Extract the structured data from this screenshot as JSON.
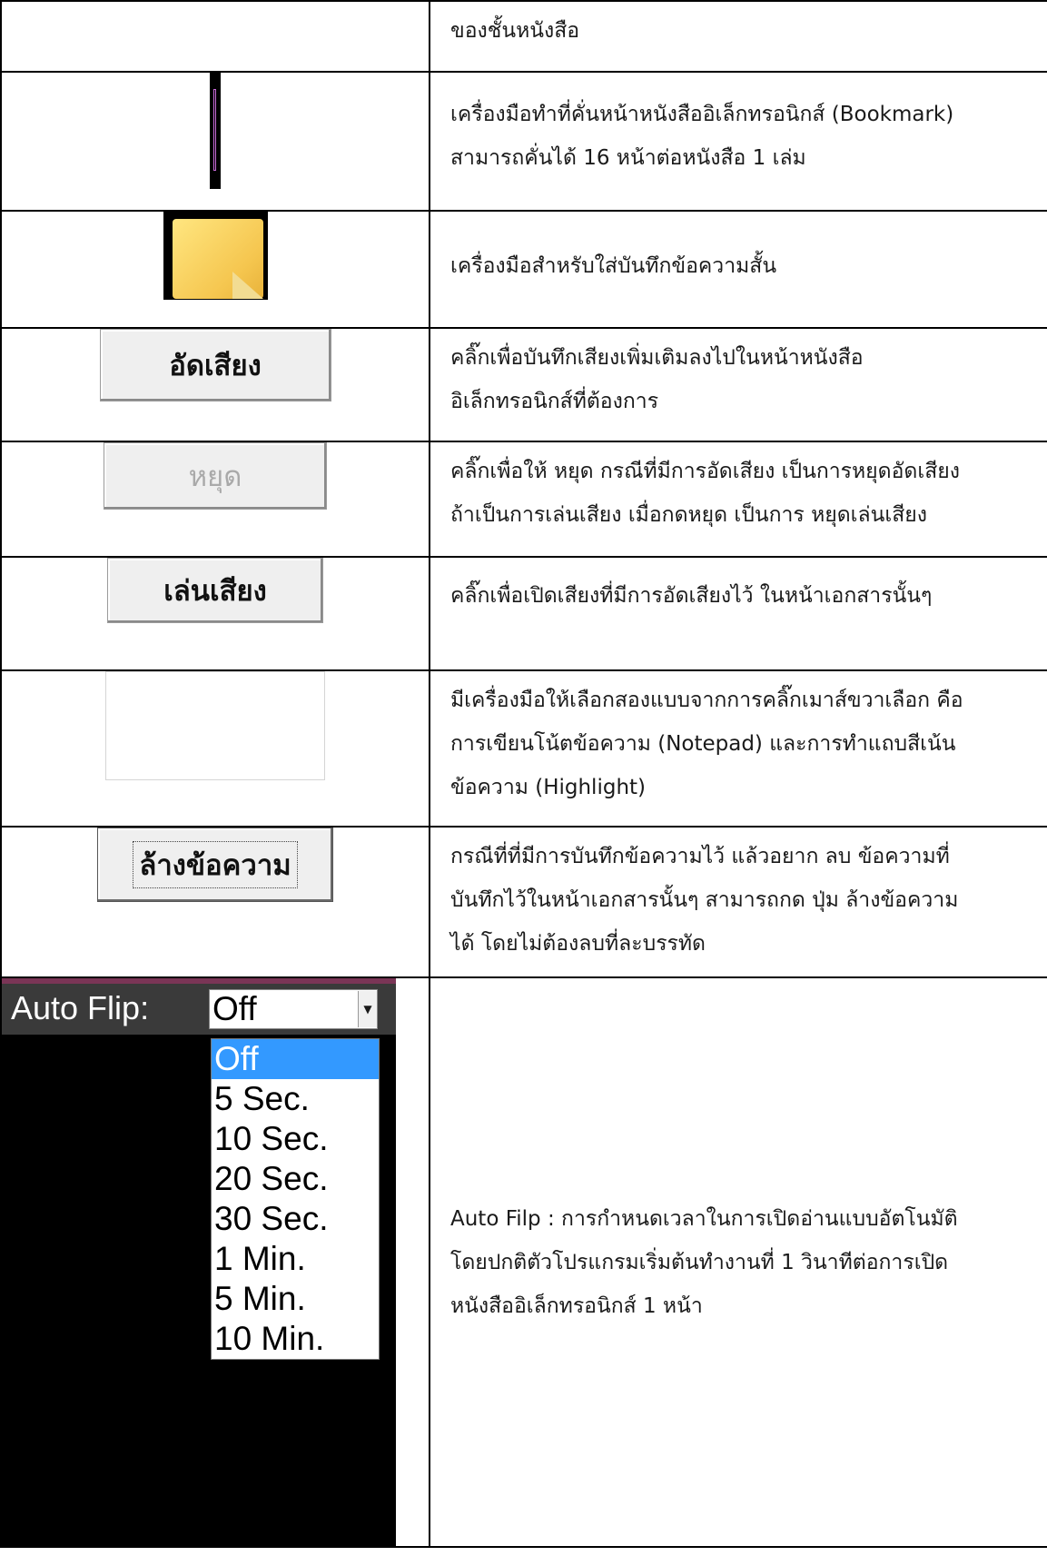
{
  "rows": [
    {
      "desc": [
        "ของชั้นหนังสือ"
      ]
    },
    {
      "desc": [
        "เครื่องมือทำที่คั่นหน้าหนังสืออิเล็กทรอนิกส์ (Bookmark)",
        "สามารถคั่นได้ 16 หน้าต่อหนังสือ 1 เล่ม"
      ],
      "icon": "bookmark-icon"
    },
    {
      "desc": [
        "เครื่องมือสำหรับใส่บันทึกข้อความสั้น"
      ],
      "icon": "sticky-note-icon"
    },
    {
      "button": "อัดเสียง",
      "desc": [
        "คลิ๊กเพื่อบันทึกเสียงเพิ่มเติมลงไปในหน้าหนังสือ",
        "อิเล็กทรอนิกส์ที่ต้องการ"
      ]
    },
    {
      "button": "หยุด",
      "desc": [
        "คลิ๊กเพื่อให้ หยุด กรณีที่มีการอัดเสียง เป็นการหยุดอัดเสียง",
        "ถ้าเป็นการเล่นเสียง เมื่อกดหยุด เป็นการ หยุดเล่นเสียง"
      ]
    },
    {
      "button": "เล่นเสียง",
      "desc": [
        "คลิ๊กเพื่อเปิดเสียงที่มีการอัดเสียงไว้ ในหน้าเอกสารนั้นๆ"
      ]
    },
    {
      "desc": [
        "มีเครื่องมือให้เลือกสองแบบจากการคลิ๊กเมาส์ขวาเลือก คือ",
        "การเขียนโน้ตข้อความ   (Notepad) และการทำแถบสีเน้น",
        "ข้อความ (Highlight)"
      ]
    },
    {
      "button": "ล้างข้อความ",
      "desc": [
        "กรณีที่ที่มีการบันทึกข้อความไว้ แล้วอยาก ลบ ข้อความที่",
        "บันทึกไว้ในหน้าเอกสารนั้นๆ สามารถกด ปุ่ม ล้างข้อความ",
        "ได้ โดยไม่ต้องลบที่ละบรรทัด"
      ]
    },
    {
      "desc": [
        "Auto Filp : การกำหนดเวลาในการเปิดอ่านแบบอัตโนมัติ",
        "โดยปกติตัวโปรแกรมเริ่มต้นทำงานที่ 1 วินาทีต่อการเปิด",
        "หนังสืออิเล็กทรอนิกส์ 1 หน้า"
      ]
    }
  ],
  "autoflip": {
    "label": "Auto Flip:",
    "selected": "Off",
    "options": [
      "Off",
      "5 Sec.",
      "10 Sec.",
      "20 Sec.",
      "30 Sec.",
      "1 Min.",
      "5 Min.",
      "10 Min."
    ]
  }
}
